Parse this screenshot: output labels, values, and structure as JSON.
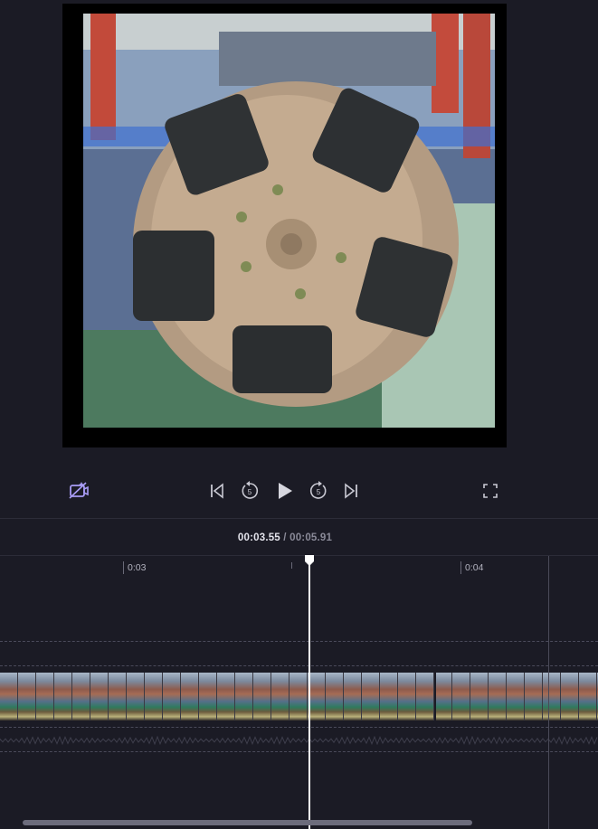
{
  "player": {
    "video_description": "",
    "controls": {
      "ai_camera": "camera-sparkle-icon",
      "skip_start": "skip-back-icon",
      "rewind_5": "rewind-5-icon",
      "rewind_5_label": "5",
      "play": "play-icon",
      "forward_5": "forward-5-icon",
      "forward_5_label": "5",
      "skip_end": "skip-forward-icon",
      "fullscreen": "fullscreen-icon"
    }
  },
  "timeline": {
    "current_time": "00:03.55",
    "separator": " / ",
    "total_time": "00:05.91",
    "ruler_labels": [
      "0:03",
      "0:04"
    ],
    "accent_color": "#a99cf5"
  }
}
